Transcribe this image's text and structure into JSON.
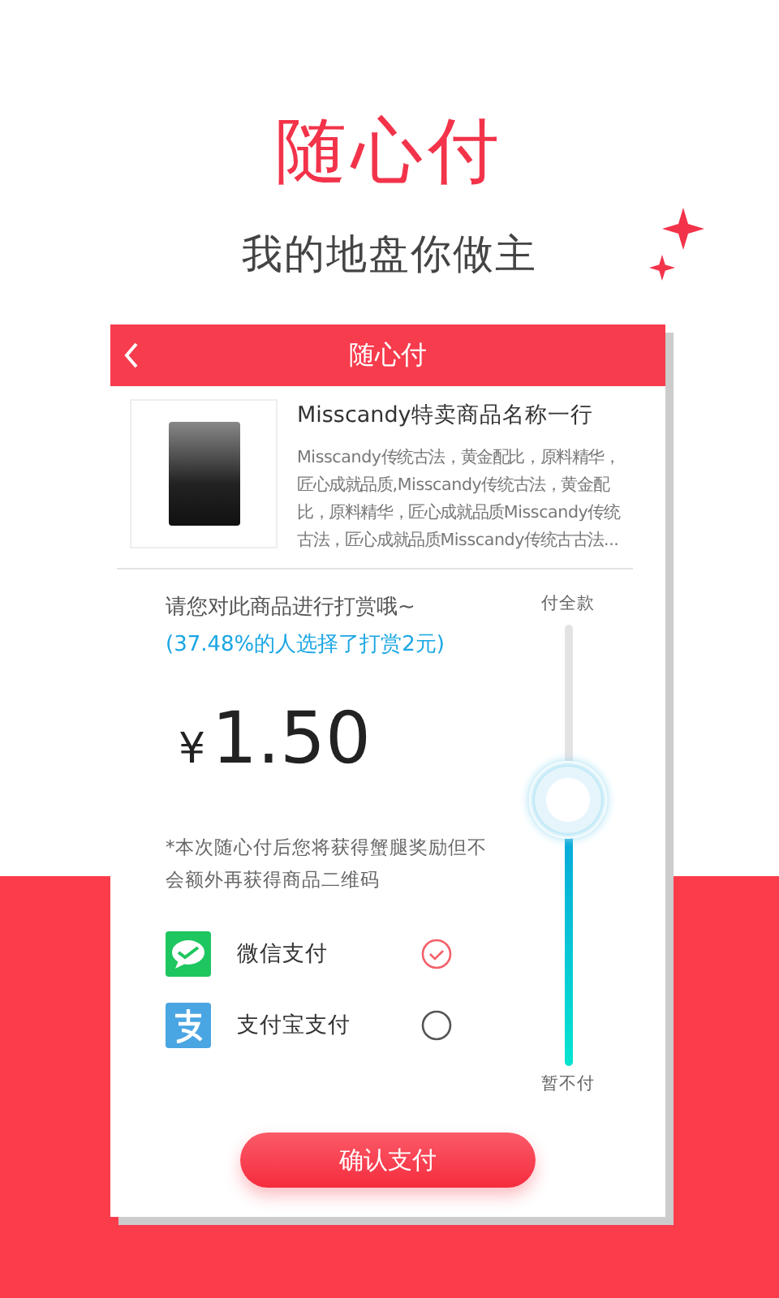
{
  "hero": {
    "title": "随心付",
    "subtitle": "我的地盘你做主"
  },
  "card": {
    "header": {
      "title": "随心付"
    },
    "product": {
      "name": "Misscandy特卖商品名称一行",
      "description": "Misscandy传统古法，黄金配比，原料精华，匠心成就品质,Misscandy传统古法，黄金配比，原料精华，匠心成就品质Misscandy传统古法，匠心成就品质Misscandy传统古古法..."
    },
    "prompt": "请您对此商品进行打赏哦~",
    "stat": "(37.48%的人选择了打赏2元)",
    "amount": {
      "currency": "¥",
      "value": "1.50"
    },
    "note": "*本次随心付后您将获得蟹腿奖励但不会额外再获得商品二维码",
    "slider": {
      "top_label": "付全款",
      "bottom_label": "暂不付",
      "level": 0.6
    },
    "payment_methods": [
      {
        "kind": "wechat",
        "label": "微信支付",
        "selected": true
      },
      {
        "kind": "alipay",
        "label": "支付宝支付",
        "selected": false
      }
    ],
    "confirm_button": "确认支付"
  }
}
